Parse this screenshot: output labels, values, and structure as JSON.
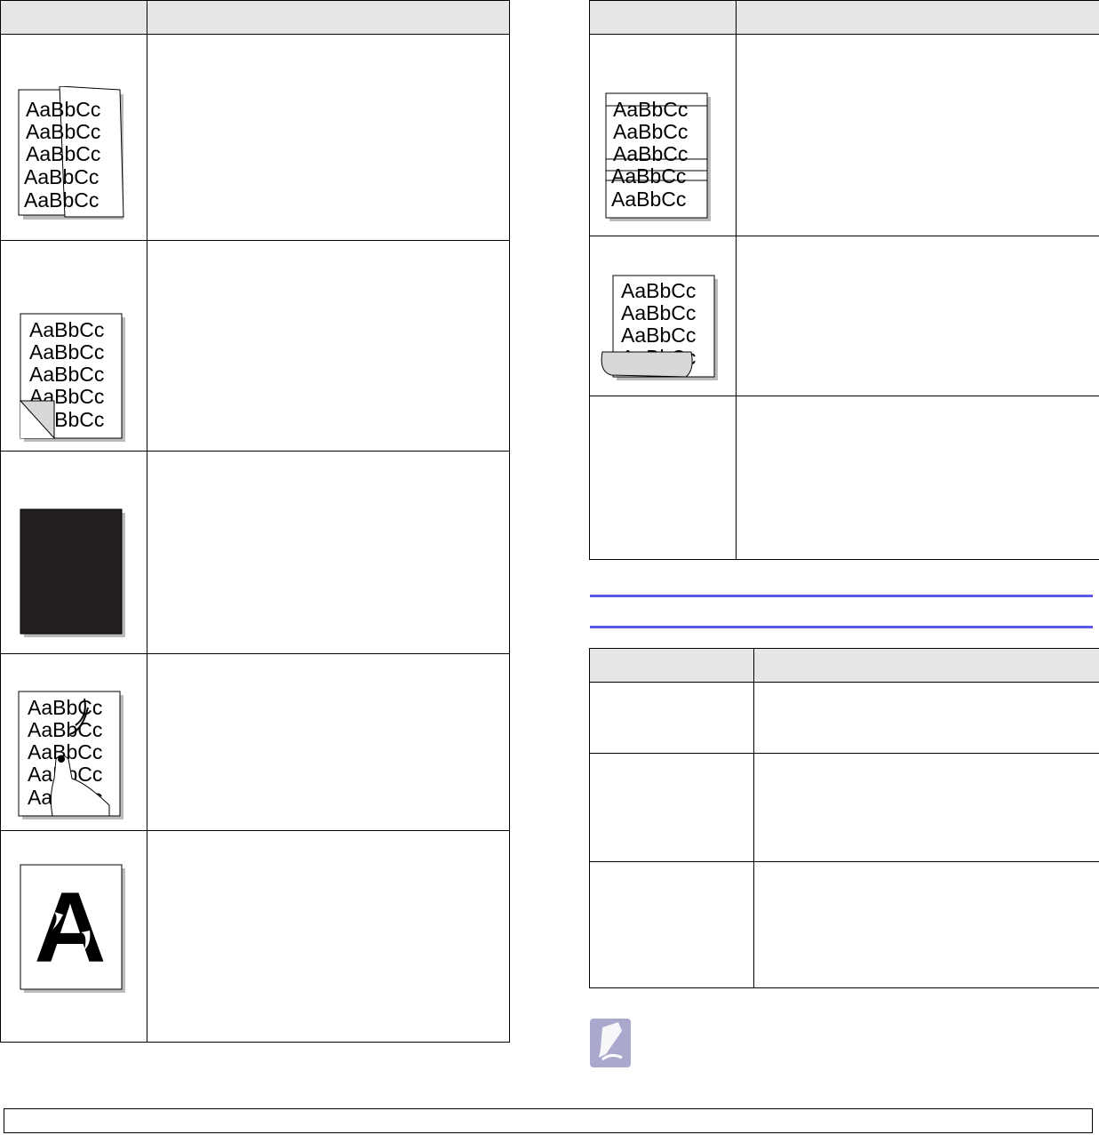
{
  "left_table": {
    "headers": [
      "",
      ""
    ],
    "rows": [
      {
        "sample_icon": "torn-page-sample-icon",
        "sample_lines": [
          "AaBbCc",
          "AaBbCc",
          "AaBbCc",
          "AaBbCc",
          "AaBbCc"
        ],
        "description": ""
      },
      {
        "sample_icon": "folded-corner-sample-icon",
        "sample_lines": [
          "AaBbCc",
          "AaBbCc",
          "AaBbCc",
          "AaBbCc",
          "AaBbCc"
        ],
        "description": ""
      },
      {
        "sample_icon": "black-page-sample-icon",
        "sample_lines": [],
        "description": ""
      },
      {
        "sample_icon": "smudged-hand-sample-icon",
        "sample_lines": [
          "AaBbCc",
          "AaBbCc",
          "AaBbCc",
          "AaBbCc",
          "AaBbCc"
        ],
        "description": ""
      },
      {
        "sample_icon": "character-voids-sample-icon",
        "sample_lines": [
          "A"
        ],
        "description": ""
      }
    ]
  },
  "right_table": {
    "headers": [
      "",
      ""
    ],
    "rows": [
      {
        "sample_icon": "horizontal-stripes-sample-icon",
        "sample_lines": [
          "AaBbCc",
          "AaBbCc",
          "AaBbCc",
          "AaBbCc",
          "AaBbCc"
        ],
        "description": ""
      },
      {
        "sample_icon": "curl-sample-icon",
        "sample_lines": [
          "AaBbCc",
          "AaBbCc",
          "AaBbCc",
          "AaBbCc"
        ],
        "description": ""
      },
      {
        "sample_icon": "",
        "sample_lines": [],
        "description": ""
      }
    ]
  },
  "section": {
    "heading": ""
  },
  "lower_table": {
    "headers": [
      "",
      ""
    ],
    "rows": [
      {
        "condition": "",
        "solution": ""
      },
      {
        "condition": "",
        "solution": ""
      },
      {
        "condition": "",
        "solution": ""
      }
    ]
  },
  "note": {
    "icon": "note-pencil-icon",
    "text": ""
  },
  "footer": {
    "text": ""
  },
  "colors": {
    "rule": "#5a5ae6",
    "header_bg": "#e6e6e6",
    "note_icon": "#aaa8cc"
  }
}
